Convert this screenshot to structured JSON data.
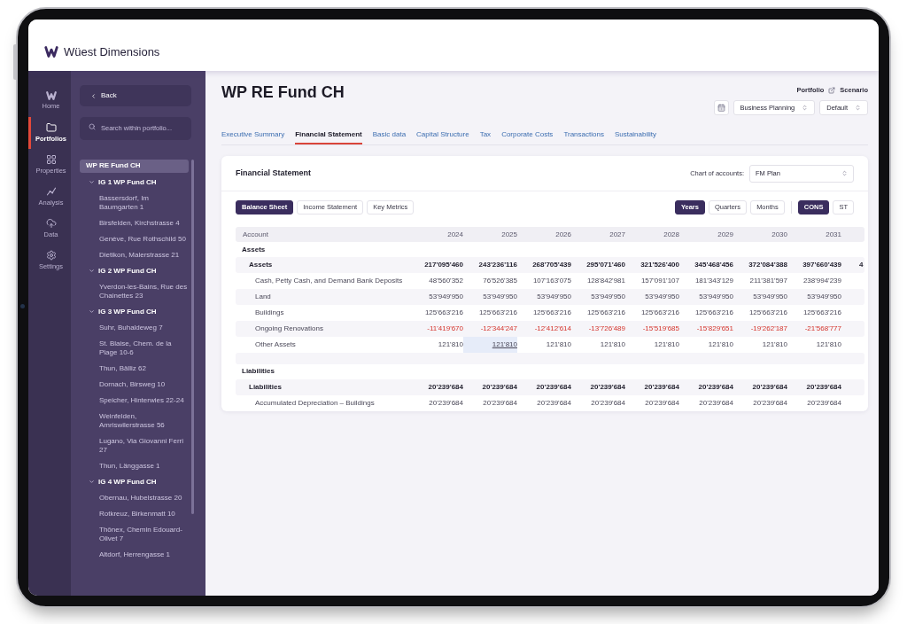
{
  "app": {
    "name": "Wüest Dimensions"
  },
  "nav_rail": [
    {
      "label": "Home",
      "selected": false
    },
    {
      "label": "Portfolios",
      "selected": true
    },
    {
      "label": "Properties",
      "selected": false
    },
    {
      "label": "Analysis",
      "selected": false
    },
    {
      "label": "Data",
      "selected": false
    },
    {
      "label": "Settings",
      "selected": false
    }
  ],
  "sidebar": {
    "back": "Back",
    "search": {
      "placeholder": "Search within portfolio..."
    },
    "tree": [
      {
        "label": "WP RE Fund CH",
        "selected": true,
        "children": [
          {
            "label": "IG 1 WP Fund CH",
            "selected": false,
            "expanded": true,
            "children": [
              {
                "label": "Bassersdorf, Im Baumgarten 1",
                "selected": false
              },
              {
                "label": "Birsfelden, Kirchstrasse 4",
                "selected": false
              },
              {
                "label": "Genève, Rue Rothschild 50",
                "selected": false
              },
              {
                "label": "Dietikon, Malerstrasse 21",
                "selected": false
              }
            ]
          },
          {
            "label": "IG 2 WP Fund CH",
            "selected": false,
            "expanded": true,
            "children": [
              {
                "label": "Yverdon-les-Bains, Rue des Chainettes 23",
                "selected": false
              }
            ]
          },
          {
            "label": "IG 3 WP Fund CH",
            "selected": false,
            "expanded": true,
            "children": [
              {
                "label": "Suhr, Buhaldeweg 7",
                "selected": false
              },
              {
                "label": "St. Blaise, Chem. de la Plage 10-6",
                "selected": false
              },
              {
                "label": "Thun, Bälliz 62",
                "selected": false
              },
              {
                "label": "Dornach, Birsweg 10",
                "selected": false
              },
              {
                "label": "Speicher, Hinterwies 22-24",
                "selected": false
              },
              {
                "label": "Weinfelden, Amriswilerstrasse 56",
                "selected": false
              },
              {
                "label": "Lugano, Via Giovanni Ferri 27",
                "selected": false
              },
              {
                "label": "Thun, Länggasse 1",
                "selected": false
              }
            ]
          },
          {
            "label": "IG 4 WP Fund CH",
            "selected": false,
            "expanded": true,
            "children": [
              {
                "label": "Obernau, Hubelstrasse 20",
                "selected": false
              },
              {
                "label": "Rotkreuz, Birkenmatt 10",
                "selected": false
              },
              {
                "label": "Thônex, Chemin Edouard-Olivet 7",
                "selected": false
              },
              {
                "label": "Altdorf, Herrengasse 1",
                "selected": false
              }
            ]
          }
        ]
      }
    ]
  },
  "header": {
    "title": "WP RE Fund CH",
    "links": [
      "Portfolio",
      "Scenario"
    ],
    "selects": [
      {
        "value": "Business Planning"
      },
      {
        "value": "Default"
      }
    ]
  },
  "tabs": [
    {
      "label": "Executive Summary",
      "selected": false
    },
    {
      "label": "Financial Statement",
      "selected": true
    },
    {
      "label": "Basic data",
      "selected": false
    },
    {
      "label": "Capital Structure",
      "selected": false
    },
    {
      "label": "Tax",
      "selected": false
    },
    {
      "label": "Corporate Costs",
      "selected": false
    },
    {
      "label": "Transactions",
      "selected": false
    },
    {
      "label": "Sustainability",
      "selected": false
    }
  ],
  "card": {
    "title": "Financial Statement",
    "chart_of_accounts": {
      "label": "Chart of accounts:",
      "value": "FM Plan"
    },
    "views": [
      {
        "label": "Balance Sheet",
        "selected": true
      },
      {
        "label": "Income Statement",
        "selected": false
      },
      {
        "label": "Key Metrics",
        "selected": false
      }
    ],
    "periods": [
      {
        "label": "Years",
        "selected": true
      },
      {
        "label": "Quarters",
        "selected": false
      },
      {
        "label": "Months",
        "selected": false
      }
    ],
    "scopes": [
      {
        "label": "CONS",
        "selected": true
      },
      {
        "label": "ST",
        "selected": false
      }
    ]
  },
  "table": {
    "columns": [
      "Account",
      "2024",
      "2025",
      "2026",
      "2027",
      "2028",
      "2029",
      "2030",
      "2031"
    ],
    "rows": [
      {
        "kind": "section",
        "account": "Assets"
      },
      {
        "kind": "group",
        "account": "Assets",
        "negative": false,
        "values": [
          {
            "text": "217'095'460",
            "selected": false
          },
          {
            "text": "243'236'116",
            "selected": false
          },
          {
            "text": "268'705'439",
            "selected": false
          },
          {
            "text": "295'071'460",
            "selected": false
          },
          {
            "text": "321'526'400",
            "selected": false
          },
          {
            "text": "345'468'456",
            "selected": false
          },
          {
            "text": "372'084'388",
            "selected": false
          },
          {
            "text": "397'660'439",
            "selected": false
          },
          {
            "text": "4",
            "selected": false
          }
        ]
      },
      {
        "kind": "item",
        "account": "Cash, Petty Cash, and Demand Bank Deposits",
        "negative": false,
        "values": [
          {
            "text": "48'560'352",
            "selected": false
          },
          {
            "text": "76'526'385",
            "selected": false
          },
          {
            "text": "107'163'075",
            "selected": false
          },
          {
            "text": "128'842'981",
            "selected": false
          },
          {
            "text": "157'091'107",
            "selected": false
          },
          {
            "text": "181'343'129",
            "selected": false
          },
          {
            "text": "211'381'597",
            "selected": false
          },
          {
            "text": "238'994'239",
            "selected": false
          }
        ]
      },
      {
        "kind": "item",
        "account": "Land",
        "negative": false,
        "values": [
          {
            "text": "53'949'950",
            "selected": false
          },
          {
            "text": "53'949'950",
            "selected": false
          },
          {
            "text": "53'949'950",
            "selected": false
          },
          {
            "text": "53'949'950",
            "selected": false
          },
          {
            "text": "53'949'950",
            "selected": false
          },
          {
            "text": "53'949'950",
            "selected": false
          },
          {
            "text": "53'949'950",
            "selected": false
          },
          {
            "text": "53'949'950",
            "selected": false
          }
        ]
      },
      {
        "kind": "item",
        "account": "Buildings",
        "negative": false,
        "values": [
          {
            "text": "125'663'216",
            "selected": false
          },
          {
            "text": "125'663'216",
            "selected": false
          },
          {
            "text": "125'663'216",
            "selected": false
          },
          {
            "text": "125'663'216",
            "selected": false
          },
          {
            "text": "125'663'216",
            "selected": false
          },
          {
            "text": "125'663'216",
            "selected": false
          },
          {
            "text": "125'663'216",
            "selected": false
          },
          {
            "text": "125'663'216",
            "selected": false
          }
        ]
      },
      {
        "kind": "item",
        "account": "Ongoing Renovations",
        "negative": true,
        "values": [
          {
            "text": "-11'419'670",
            "selected": false
          },
          {
            "text": "-12'344'247",
            "selected": false
          },
          {
            "text": "-12'412'614",
            "selected": false
          },
          {
            "text": "-13'726'489",
            "selected": false
          },
          {
            "text": "-15'519'685",
            "selected": false
          },
          {
            "text": "-15'829'651",
            "selected": false
          },
          {
            "text": "-19'262'187",
            "selected": false
          },
          {
            "text": "-21'568'777",
            "selected": false
          }
        ]
      },
      {
        "kind": "item",
        "account": "Other Assets",
        "negative": false,
        "values": [
          {
            "text": "121'810",
            "selected": false
          },
          {
            "text": "121'810",
            "selected": true
          },
          {
            "text": "121'810",
            "selected": false
          },
          {
            "text": "121'810",
            "selected": false
          },
          {
            "text": "121'810",
            "selected": false
          },
          {
            "text": "121'810",
            "selected": false
          },
          {
            "text": "121'810",
            "selected": false
          },
          {
            "text": "121'810",
            "selected": false
          }
        ]
      },
      {
        "kind": "spacer"
      },
      {
        "kind": "section",
        "account": "Liabilities"
      },
      {
        "kind": "group",
        "account": "Liabilities",
        "negative": false,
        "values": [
          {
            "text": "20'239'684",
            "selected": false
          },
          {
            "text": "20'239'684",
            "selected": false
          },
          {
            "text": "20'239'684",
            "selected": false
          },
          {
            "text": "20'239'684",
            "selected": false
          },
          {
            "text": "20'239'684",
            "selected": false
          },
          {
            "text": "20'239'684",
            "selected": false
          },
          {
            "text": "20'239'684",
            "selected": false
          },
          {
            "text": "20'239'684",
            "selected": false
          }
        ]
      },
      {
        "kind": "item",
        "account": "Accumulated Depreciation – Buildings",
        "negative": false,
        "values": [
          {
            "text": "20'239'684",
            "selected": false
          },
          {
            "text": "20'239'684",
            "selected": false
          },
          {
            "text": "20'239'684",
            "selected": false
          },
          {
            "text": "20'239'684",
            "selected": false
          },
          {
            "text": "20'239'684",
            "selected": false
          },
          {
            "text": "20'239'684",
            "selected": false
          },
          {
            "text": "20'239'684",
            "selected": false
          },
          {
            "text": "20'239'684",
            "selected": false
          }
        ]
      }
    ]
  }
}
